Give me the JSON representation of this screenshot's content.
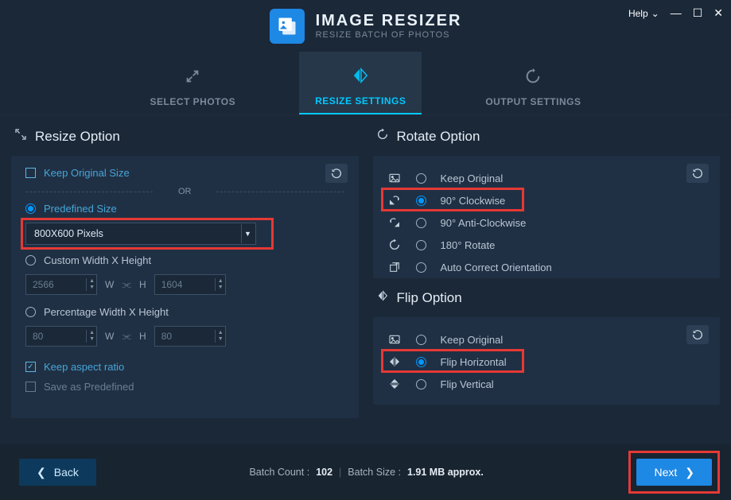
{
  "header": {
    "title": "IMAGE RESIZER",
    "subtitle": "RESIZE BATCH OF PHOTOS",
    "help_label": "Help"
  },
  "tabs": {
    "select": "SELECT PHOTOS",
    "resize": "RESIZE SETTINGS",
    "output": "OUTPUT SETTINGS"
  },
  "resize": {
    "title": "Resize Option",
    "keep_original": "Keep Original Size",
    "or": "OR",
    "predefined_label": "Predefined Size",
    "predefined_value": "800X600 Pixels",
    "custom_label": "Custom Width X Height",
    "custom_w": "2566",
    "custom_h": "1604",
    "percent_label": "Percentage Width X Height",
    "percent_w": "80",
    "percent_h": "80",
    "w_label": "W",
    "h_label": "H",
    "keep_aspect": "Keep aspect ratio",
    "save_predefined": "Save as Predefined"
  },
  "rotate": {
    "title": "Rotate Option",
    "keep": "Keep Original",
    "cw90": "90° Clockwise",
    "acw90": "90° Anti-Clockwise",
    "r180": "180° Rotate",
    "auto": "Auto Correct Orientation"
  },
  "flip": {
    "title": "Flip Option",
    "keep": "Keep Original",
    "horiz": "Flip Horizontal",
    "vert": "Flip Vertical"
  },
  "footer": {
    "back": "Back",
    "next": "Next",
    "batch_count_label": "Batch Count :",
    "batch_count": "102",
    "batch_size_label": "Batch Size :",
    "batch_size": "1.91 MB approx."
  }
}
